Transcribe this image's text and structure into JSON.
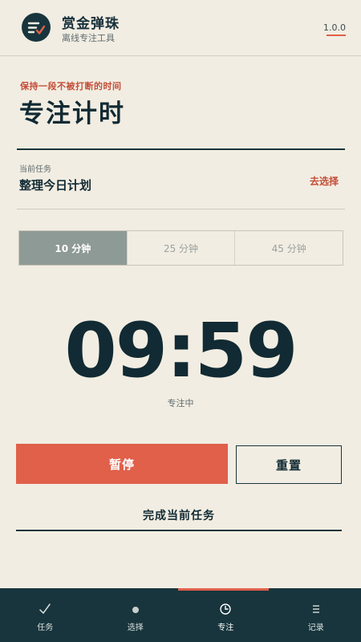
{
  "app": {
    "title": "赏金弹珠",
    "subtitle": "离线专注工具",
    "version": "1.0.0"
  },
  "focus": {
    "tagline": "保持一段不被打断的时间",
    "title": "专注计时",
    "task_label": "当前任务",
    "task_name": "整理今日计划",
    "choose_label": "去选择",
    "durations": [
      {
        "label": "10 分钟",
        "active": true
      },
      {
        "label": "25 分钟",
        "active": false
      },
      {
        "label": "45 分钟",
        "active": false
      }
    ],
    "timer": "09:59",
    "status": "专注中",
    "pause_label": "暂停",
    "reset_label": "重置",
    "complete_label": "完成当前任务"
  },
  "nav": {
    "items": [
      {
        "label": "任务",
        "icon": "check-icon"
      },
      {
        "label": "选择",
        "icon": "dot-icon"
      },
      {
        "label": "专注",
        "icon": "clock-icon",
        "active": true
      },
      {
        "label": "记录",
        "icon": "list-icon"
      }
    ]
  },
  "colors": {
    "background": "#f2ede2",
    "dark": "#18353d",
    "accent": "#e0604a",
    "accent_text": "#c34d38",
    "active_segment": "#8e9a95"
  }
}
